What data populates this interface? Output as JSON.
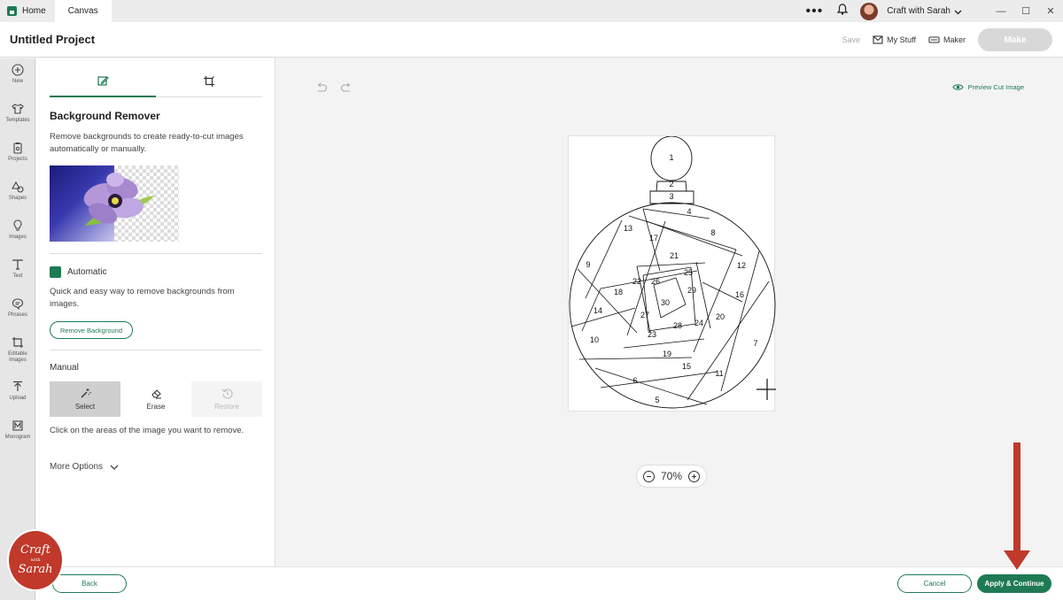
{
  "titlebar": {
    "tabs": [
      "Home",
      "Canvas"
    ],
    "user_name": "Craft with Sarah"
  },
  "header": {
    "project_title": "Untitled Project",
    "save_label": "Save",
    "my_stuff_label": "My Stuff",
    "maker_label": "Maker",
    "make_label": "Make"
  },
  "rail": {
    "items": [
      {
        "label": "New",
        "icon": "plus-circle-icon"
      },
      {
        "label": "Templates",
        "icon": "shirt-icon"
      },
      {
        "label": "Projects",
        "icon": "clipboard-icon"
      },
      {
        "label": "Shapes",
        "icon": "shapes-icon"
      },
      {
        "label": "Images",
        "icon": "lightbulb-icon"
      },
      {
        "label": "Text",
        "icon": "text-icon"
      },
      {
        "label": "Phrases",
        "icon": "speech-bubble-icon"
      },
      {
        "label": "Editable Images",
        "icon": "crop-image-icon"
      },
      {
        "label": "Upload",
        "icon": "upload-icon"
      },
      {
        "label": "Monogram",
        "icon": "monogram-icon"
      }
    ]
  },
  "panel": {
    "tabs": [
      {
        "name": "background-remover-tab",
        "active": true
      },
      {
        "name": "crop-tab",
        "active": false
      }
    ],
    "title": "Background Remover",
    "description": "Remove backgrounds to create ready-to-cut images automatically or manually.",
    "automatic": {
      "label": "Automatic",
      "description": "Quick and easy way to remove backgrounds from images.",
      "button": "Remove Background"
    },
    "manual": {
      "label": "Manual",
      "tools": [
        {
          "label": "Select",
          "icon": "magic-wand-icon",
          "state": "selected"
        },
        {
          "label": "Erase",
          "icon": "eraser-icon",
          "state": "normal"
        },
        {
          "label": "Restore",
          "icon": "restore-icon",
          "state": "disabled"
        }
      ],
      "description": "Click on the areas of the image you want to remove."
    },
    "more_options": "More Options"
  },
  "canvas": {
    "preview_label": "Preview Cut Image",
    "zoom": "70%",
    "ornament_numbers": [
      "1",
      "2",
      "3",
      "4",
      "5",
      "6",
      "7",
      "8",
      "9",
      "10",
      "11",
      "12",
      "13",
      "14",
      "15",
      "16",
      "17",
      "18",
      "19",
      "20",
      "21",
      "22",
      "23",
      "24",
      "25",
      "26",
      "27",
      "28",
      "29",
      "30"
    ]
  },
  "footer": {
    "back_label": "Back",
    "cancel_label": "Cancel",
    "apply_label": "Apply & Continue"
  },
  "branding": {
    "line1": "Craft",
    "line2": "with",
    "line3": "Sarah"
  },
  "colors": {
    "accent": "#1f7a53",
    "annotation_arrow": "#c0392b"
  }
}
